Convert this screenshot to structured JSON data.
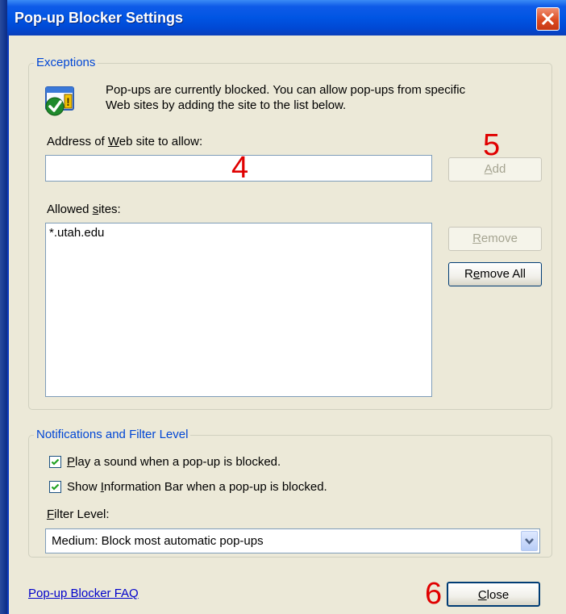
{
  "window": {
    "title": "Pop-up Blocker Settings"
  },
  "exceptions": {
    "legend": "Exceptions",
    "info_line1": "Pop-ups are currently blocked.  You can allow pop-ups from specific",
    "info_line2": "Web sites by adding the site to the list below.",
    "address_label": "Address of Web site to allow:",
    "address_value": "",
    "add_label": "Add",
    "allowed_label": "Allowed sites:",
    "allowed_sites": [
      "*.utah.edu"
    ],
    "remove_label": "Remove",
    "remove_all_label": "Remove All"
  },
  "notifications": {
    "legend": "Notifications and Filter Level",
    "play_sound_label": "Play a sound when a pop-up is blocked.",
    "play_sound_checked": true,
    "info_bar_label": "Show Information Bar when a pop-up is blocked.",
    "info_bar_checked": true,
    "filter_level_label": "Filter Level:",
    "filter_level_value": "Medium: Block most automatic pop-ups"
  },
  "footer": {
    "faq_link": "Pop-up Blocker FAQ",
    "close_label": "Close"
  },
  "annotations": [
    "4",
    "5",
    "6"
  ]
}
